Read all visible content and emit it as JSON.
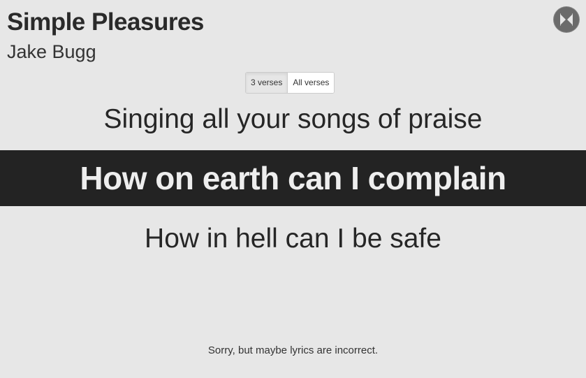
{
  "song": {
    "title": "Simple Pleasures",
    "artist": "Jake Bugg"
  },
  "close_button": {
    "icon": "close-icon"
  },
  "verse_toggle": {
    "options": [
      {
        "label": "3 verses",
        "active": true
      },
      {
        "label": "All verses",
        "active": false
      }
    ]
  },
  "lyrics": {
    "previous": "Singing all your songs of praise",
    "current": "How on earth can I complain",
    "next": "How in hell can I be safe"
  },
  "footer": {
    "note": "Sorry, but maybe lyrics are incorrect."
  },
  "colors": {
    "background": "#e7e7e7",
    "highlight_band": "#232323",
    "highlight_text": "#eeeeee",
    "text": "#2b2b2b"
  }
}
